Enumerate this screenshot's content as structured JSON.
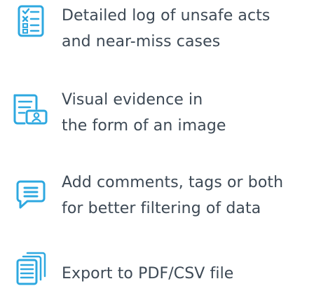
{
  "accent_color": "#2ea8e0",
  "text_color": "#3d4955",
  "features": [
    {
      "icon": "checklist-icon",
      "lines": [
        "Detailed log of unsafe acts",
        "and near-miss cases"
      ]
    },
    {
      "icon": "document-photo-icon",
      "lines": [
        "Visual evidence in",
        "the form of an image"
      ]
    },
    {
      "icon": "comment-icon",
      "lines": [
        "Add comments, tags or both",
        "for better filtering of data"
      ]
    },
    {
      "icon": "export-files-icon",
      "lines": [
        "Export to PDF/CSV file"
      ]
    }
  ]
}
